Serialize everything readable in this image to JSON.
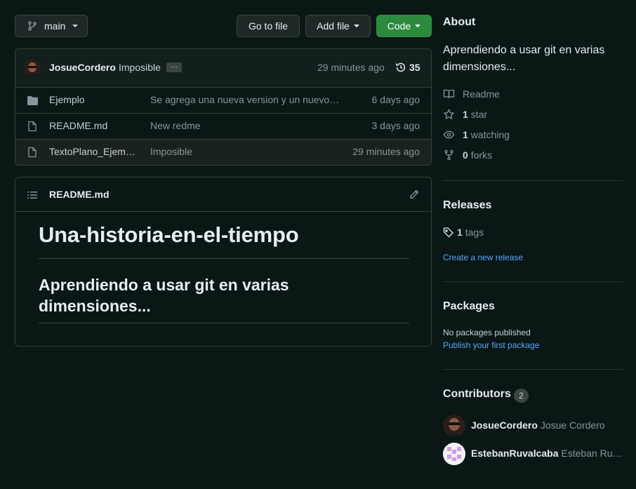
{
  "toolbar": {
    "branch": "main",
    "go_to_file": "Go to file",
    "add_file": "Add file",
    "code": "Code"
  },
  "commit": {
    "author": "JosueCordero",
    "message": "Imposible",
    "ellipsis": "···",
    "time": "29 minutes ago",
    "count": "35"
  },
  "files": [
    {
      "name": "Ejemplo",
      "type": "folder",
      "message": "Se agrega una nueva version y un nuevo…",
      "time": "6 days ago"
    },
    {
      "name": "README.md",
      "type": "file",
      "message": "New redme",
      "time": "3 days ago"
    },
    {
      "name": "TextoPlano_Ejem…",
      "type": "file",
      "message": "Imposible",
      "time": "29 minutes ago"
    }
  ],
  "readme": {
    "header": "README.md",
    "h1": "Una-historia-en-el-tiempo",
    "h2": "Aprendiendo a usar git en varias dimensiones..."
  },
  "about": {
    "title": "About",
    "description": "Aprendiendo a usar git en varias dimensiones...",
    "readme_label": "Readme",
    "stars_count": "1",
    "stars_label": "star",
    "watching_count": "1",
    "watching_label": "watching",
    "forks_count": "0",
    "forks_label": "forks"
  },
  "releases": {
    "title": "Releases",
    "tags_count": "1",
    "tags_label": "tags",
    "create_link": "Create a new release"
  },
  "packages": {
    "title": "Packages",
    "none": "No packages published",
    "publish_link": "Publish your first package"
  },
  "contributors": {
    "title": "Contributors",
    "count": "2",
    "list": [
      {
        "login": "JosueCordero",
        "name": "Josue Cordero"
      },
      {
        "login": "EstebanRuvalcaba",
        "name": "Esteban Ru…"
      }
    ]
  },
  "colors": {
    "background": "#0a1715",
    "accent_green": "#2b8a3e",
    "link": "#58a6ff"
  }
}
